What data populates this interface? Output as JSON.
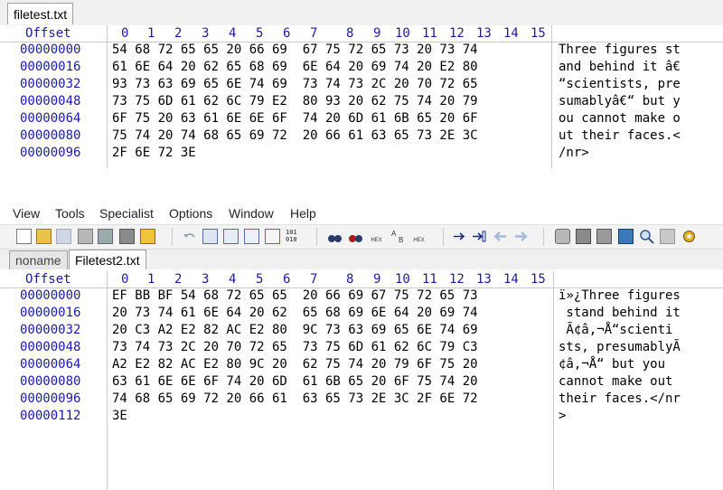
{
  "top_window": {
    "tab_label": "filetest.txt",
    "offset_header": "Offset",
    "columns": [
      "0",
      "1",
      "2",
      "3",
      "4",
      "5",
      "6",
      "7",
      "8",
      "9",
      "10",
      "11",
      "12",
      "13",
      "14",
      "15"
    ],
    "rows": [
      {
        "offset": "00000000",
        "hex": "54 68 72 65 65 20 66 69  67 75 72 65 73 20 73 74",
        "text": "Three figures st"
      },
      {
        "offset": "00000016",
        "hex": "61 6E 64 20 62 65 68 69  6E 64 20 69 74 20 E2 80",
        "text": "and behind it â€"
      },
      {
        "offset": "00000032",
        "hex": "93 73 63 69 65 6E 74 69  73 74 73 2C 20 70 72 65",
        "text": "“scientists, pre"
      },
      {
        "offset": "00000048",
        "hex": "73 75 6D 61 62 6C 79 E2  80 93 20 62 75 74 20 79",
        "text": "sumablyâ€“ but y"
      },
      {
        "offset": "00000064",
        "hex": "6F 75 20 63 61 6E 6E 6F  74 20 6D 61 6B 65 20 6F",
        "text": "ou cannot make o"
      },
      {
        "offset": "00000080",
        "hex": "75 74 20 74 68 65 69 72  20 66 61 63 65 73 2E 3C",
        "text": "ut their faces.<"
      },
      {
        "offset": "00000096",
        "hex": "2F 6E 72 3E",
        "text": "/nr>"
      }
    ]
  },
  "menu": [
    "View",
    "Tools",
    "Specialist",
    "Options",
    "Window",
    "Help"
  ],
  "toolbar_icons": [
    "new-icon",
    "open-icon",
    "save-icon",
    "print-icon",
    "print-preview-icon",
    "properties-icon",
    "folder-icon",
    "undo-icon",
    "copy-icon",
    "paste-icon",
    "paste-special-icon",
    "clipboard-icon",
    "binary-icon",
    "find-icon",
    "find-replace-icon",
    "find-hex-icon",
    "find-text-icon",
    "replace-hex-icon",
    "goto-icon",
    "goto-block-icon",
    "back-icon",
    "forward-icon",
    "disk-icon",
    "ram-icon",
    "tools-icon",
    "calculator-icon",
    "zoom-icon",
    "comment-icon",
    "settings-icon"
  ],
  "bottom_window": {
    "tabs": [
      "noname",
      "Filetest2.txt"
    ],
    "offset_header": "Offset",
    "columns": [
      "0",
      "1",
      "2",
      "3",
      "4",
      "5",
      "6",
      "7",
      "8",
      "9",
      "10",
      "11",
      "12",
      "13",
      "14",
      "15"
    ],
    "rows": [
      {
        "offset": "00000000",
        "hex": "EF BB BF 54 68 72 65 65  20 66 69 67 75 72 65 73",
        "text": "ï»¿Three figures"
      },
      {
        "offset": "00000016",
        "hex": "20 73 74 61 6E 64 20 62  65 68 69 6E 64 20 69 74",
        "text": " stand behind it"
      },
      {
        "offset": "00000032",
        "hex": "20 C3 A2 E2 82 AC E2 80  9C 73 63 69 65 6E 74 69",
        "text": " Ã¢â‚¬Å“scienti"
      },
      {
        "offset": "00000048",
        "hex": "73 74 73 2C 20 70 72 65  73 75 6D 61 62 6C 79 C3",
        "text": "sts, presumablyÃ"
      },
      {
        "offset": "00000064",
        "hex": "A2 E2 82 AC E2 80 9C 20  62 75 74 20 79 6F 75 20",
        "text": "¢â‚¬Å“ but you "
      },
      {
        "offset": "00000080",
        "hex": "63 61 6E 6E 6F 74 20 6D  61 6B 65 20 6F 75 74 20",
        "text": "cannot make out "
      },
      {
        "offset": "00000096",
        "hex": "74 68 65 69 72 20 66 61  63 65 73 2E 3C 2F 6E 72",
        "text": "their faces.</nr"
      },
      {
        "offset": "00000112",
        "hex": "3E",
        "text": ">"
      }
    ]
  },
  "colors": {
    "offset_blue": "#1a1aa8",
    "grid_line": "#c8c8c8",
    "toolbar_bg": "#f3f3f3"
  }
}
